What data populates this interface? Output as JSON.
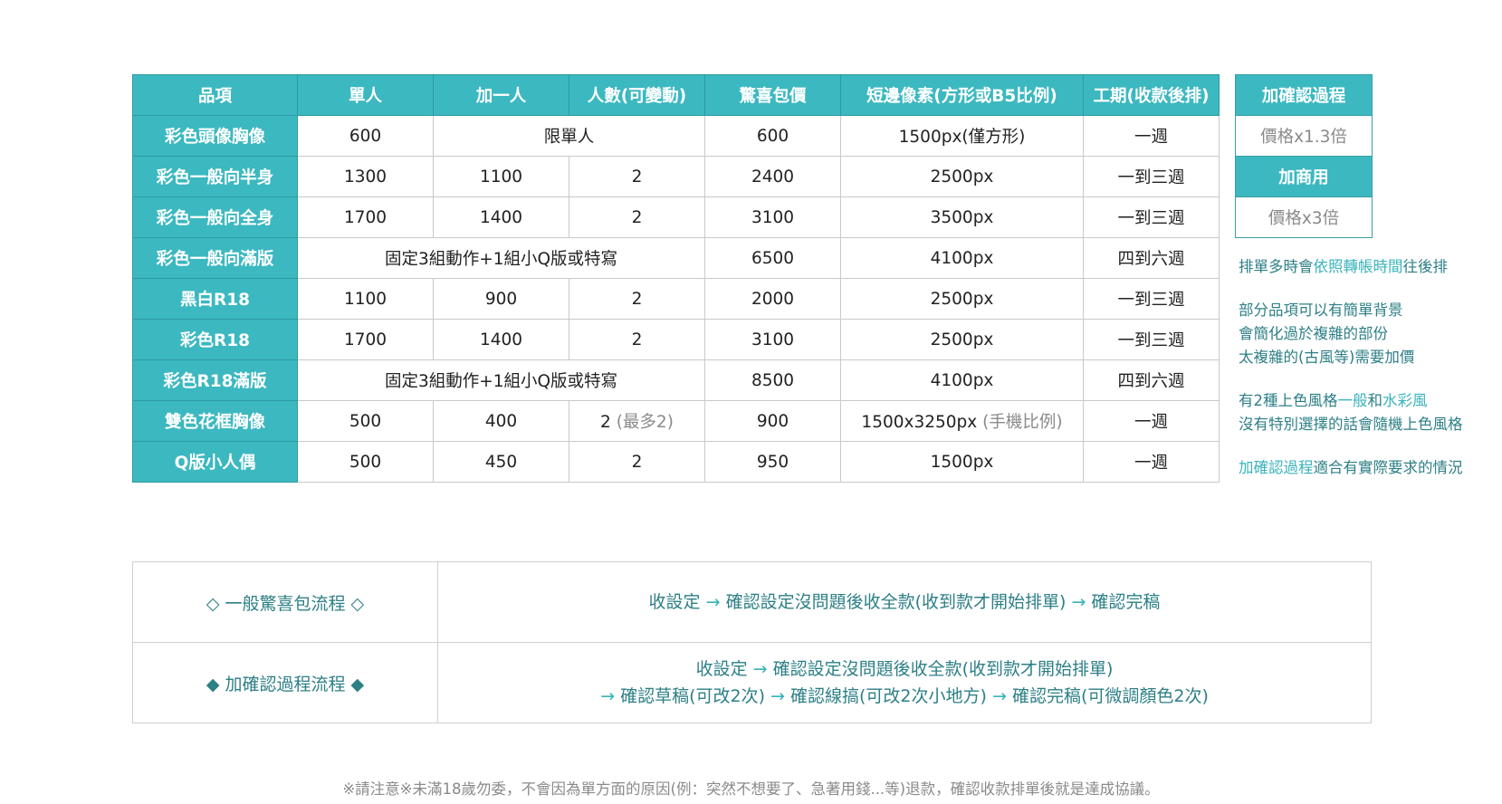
{
  "price_table": {
    "headers": [
      "品項",
      "單人",
      "加一人",
      "人數(可變動)",
      "驚喜包價",
      "短邊像素(方形或B5比例)",
      "工期(收款後排)"
    ],
    "rows": [
      {
        "item": "彩色頭像胸像",
        "single": "600",
        "merged": "限單人",
        "surprise": "600",
        "pixels": "1500px(僅方形)",
        "pixels_note": "",
        "period": "一週"
      },
      {
        "item": "彩色一般向半身",
        "single": "1300",
        "add_one": "1100",
        "people": "2",
        "people_note": "",
        "surprise": "2400",
        "pixels": "2500px",
        "pixels_note": "",
        "period": "一到三週"
      },
      {
        "item": "彩色一般向全身",
        "single": "1700",
        "add_one": "1400",
        "people": "2",
        "people_note": "",
        "surprise": "3100",
        "pixels": "3500px",
        "pixels_note": "",
        "period": "一到三週"
      },
      {
        "item": "彩色一般向滿版",
        "merged3": "固定3組動作+1組小Q版或特寫",
        "surprise": "6500",
        "pixels": "4100px",
        "pixels_note": "",
        "period": "四到六週"
      },
      {
        "item": "黑白R18",
        "single": "1100",
        "add_one": "900",
        "people": "2",
        "people_note": "",
        "surprise": "2000",
        "pixels": "2500px",
        "pixels_note": "",
        "period": "一到三週"
      },
      {
        "item": "彩色R18",
        "single": "1700",
        "add_one": "1400",
        "people": "2",
        "people_note": "",
        "surprise": "3100",
        "pixels": "2500px",
        "pixels_note": "",
        "period": "一到三週"
      },
      {
        "item": "彩色R18滿版",
        "merged3": "固定3組動作+1組小Q版或特寫",
        "surprise": "8500",
        "pixels": "4100px",
        "pixels_note": "",
        "period": "四到六週"
      },
      {
        "item": "雙色花框胸像",
        "single": "500",
        "add_one": "400",
        "people": "2",
        "people_note": "(最多2)",
        "surprise": "900",
        "pixels": "1500x3250px",
        "pixels_note": "(手機比例)",
        "period": "一週"
      },
      {
        "item": "Q版小人偶",
        "single": "500",
        "add_one": "450",
        "people": "2",
        "people_note": "",
        "surprise": "950",
        "pixels": "1500px",
        "pixels_note": "",
        "period": "一週"
      }
    ]
  },
  "side_table": {
    "confirm_header": "加確認過程",
    "confirm_value": "價格x1.3倍",
    "commercial_header": "加商用",
    "commercial_value": "價格x3倍"
  },
  "notes": {
    "n1_a": "排單多時會",
    "n1_b": "依照轉帳時間",
    "n1_c": "往後排",
    "n2_l1": "部分品項可以有簡單背景",
    "n2_l2": "會簡化過於複雜的部份",
    "n2_l3": "太複雜的(古風等)需要加價",
    "n3_a": "有2種上色風格",
    "n3_b": "一般",
    "n3_c": "和",
    "n3_d": "水彩風",
    "n3_l2": "沒有特別選擇的話會隨機上色風格",
    "n4_a": "加確認過程",
    "n4_b": "適合有實際要求的情況"
  },
  "flow": {
    "normal_label": "◇ 一般驚喜包流程 ◇",
    "normal_s1": "收設定",
    "normal_s2": "確認設定沒問題後收全款(收到款才開始排單)",
    "normal_s3": "確認完稿",
    "confirm_label": "◆ 加確認過程流程 ◆",
    "confirm_s1": "收設定",
    "confirm_s2": "確認設定沒問題後收全款(收到款才開始排單)",
    "confirm_s3": "確認草稿(可改2次)",
    "confirm_s4": "確認線搞(可改2次小地方)",
    "confirm_s5": "確認完稿(可微調顏色2次)",
    "arrow": "→"
  },
  "footer": "※請注意※未滿18歲勿委，不會因為單方面的原因(例：突然不想要了、急著用錢...等)退款，確認收款排單後就是達成協議。",
  "colors": {
    "teal": "#3cb8c0",
    "teal_text": "#2d7f86",
    "gray": "#8a8a8a"
  }
}
